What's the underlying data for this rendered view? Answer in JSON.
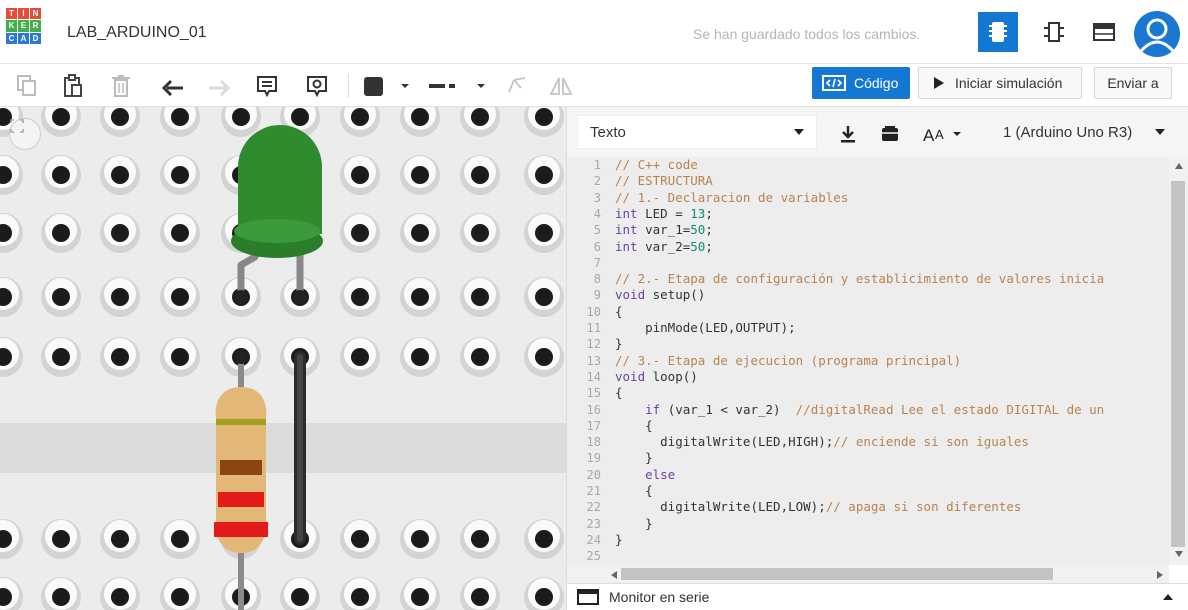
{
  "app": {
    "logo_letters": [
      "T",
      "I",
      "N",
      "K",
      "E",
      "R",
      "C",
      "A",
      "D"
    ],
    "logo_colors": [
      "#e84b3c",
      "#e84b3c",
      "#e84b3c",
      "#42b14b",
      "#42b14b",
      "#42b14b",
      "#2b7ad1",
      "#2b7ad1",
      "#2b7ad1"
    ],
    "project_title": "LAB_ARDUINO_01",
    "save_status": "Se han guardado todos los cambios."
  },
  "toolbar": {
    "code_label": "Código",
    "sim_label": "Iniciar simulación",
    "send_label": "Enviar a",
    "icons": [
      "copy-icon",
      "paste-icon",
      "trash-icon",
      "undo-icon",
      "redo-icon",
      "note-icon",
      "notes-visibility-icon",
      "color-swatch-icon",
      "line-style-icon",
      "mirror-icon",
      "flip-icon"
    ]
  },
  "code_panel": {
    "mode_select": "Texto",
    "board_select": "1 (Arduino Uno R3)",
    "monitor_label": "Monitor en serie",
    "lines": [
      {
        "n": "1",
        "segs": [
          {
            "t": "// C++ code",
            "c": "cm"
          }
        ]
      },
      {
        "n": "2",
        "segs": [
          {
            "t": "// ESTRUCTURA",
            "c": "cm"
          }
        ]
      },
      {
        "n": "3",
        "segs": [
          {
            "t": "// 1.- Declaracion de variables",
            "c": "cm"
          }
        ]
      },
      {
        "n": "4",
        "segs": [
          {
            "t": "int",
            "c": "kw"
          },
          {
            "t": " LED = ",
            "c": ""
          },
          {
            "t": "13",
            "c": "nm"
          },
          {
            "t": ";",
            "c": ""
          }
        ]
      },
      {
        "n": "5",
        "segs": [
          {
            "t": "int",
            "c": "kw"
          },
          {
            "t": " var_1=",
            "c": ""
          },
          {
            "t": "50",
            "c": "nm"
          },
          {
            "t": ";",
            "c": ""
          }
        ]
      },
      {
        "n": "6",
        "segs": [
          {
            "t": "int",
            "c": "kw"
          },
          {
            "t": " var_2=",
            "c": ""
          },
          {
            "t": "50",
            "c": "nm"
          },
          {
            "t": ";",
            "c": ""
          }
        ]
      },
      {
        "n": "7",
        "segs": []
      },
      {
        "n": "8",
        "segs": [
          {
            "t": "// 2.- Etapa de configuración y establicimiento de valores inicia",
            "c": "cm"
          }
        ]
      },
      {
        "n": "9",
        "segs": [
          {
            "t": "void",
            "c": "kw"
          },
          {
            "t": " setup()",
            "c": ""
          }
        ]
      },
      {
        "n": "10",
        "segs": [
          {
            "t": "{",
            "c": ""
          }
        ]
      },
      {
        "n": "11",
        "segs": [
          {
            "t": "    pinMode(LED,OUTPUT);",
            "c": ""
          }
        ]
      },
      {
        "n": "12",
        "segs": [
          {
            "t": "}",
            "c": ""
          }
        ]
      },
      {
        "n": "13",
        "segs": [
          {
            "t": "// 3.- Etapa de ejecucion (programa principal)",
            "c": "cm"
          }
        ]
      },
      {
        "n": "14",
        "segs": [
          {
            "t": "void",
            "c": "kw"
          },
          {
            "t": " loop()",
            "c": ""
          }
        ]
      },
      {
        "n": "15",
        "segs": [
          {
            "t": "{",
            "c": ""
          }
        ]
      },
      {
        "n": "16",
        "segs": [
          {
            "t": "    ",
            "c": ""
          },
          {
            "t": "if",
            "c": "kw"
          },
          {
            "t": " (var_1 < var_2)  ",
            "c": ""
          },
          {
            "t": "//digitalRead Lee el estado DIGITAL de un",
            "c": "cm"
          }
        ]
      },
      {
        "n": "17",
        "segs": [
          {
            "t": "    {",
            "c": ""
          }
        ]
      },
      {
        "n": "18",
        "segs": [
          {
            "t": "      digitalWrite(LED,HIGH);",
            "c": ""
          },
          {
            "t": "// enciende si son iguales",
            "c": "cm"
          }
        ]
      },
      {
        "n": "19",
        "segs": [
          {
            "t": "    }",
            "c": ""
          }
        ]
      },
      {
        "n": "20",
        "segs": [
          {
            "t": "    ",
            "c": ""
          },
          {
            "t": "else",
            "c": "kw"
          }
        ]
      },
      {
        "n": "21",
        "segs": [
          {
            "t": "    {",
            "c": ""
          }
        ]
      },
      {
        "n": "22",
        "segs": [
          {
            "t": "      digitalWrite(LED,LOW);",
            "c": ""
          },
          {
            "t": "// apaga si son diferentes",
            "c": "cm"
          }
        ]
      },
      {
        "n": "23",
        "segs": [
          {
            "t": "    }",
            "c": ""
          }
        ]
      },
      {
        "n": "24",
        "segs": [
          {
            "t": "}",
            "c": ""
          }
        ]
      },
      {
        "n": "25",
        "segs": []
      }
    ]
  },
  "circuit": {
    "led_color": "#2e8b2e",
    "resistor_bands": [
      "#5a3a1a",
      "#8b4513",
      "#e31b1b",
      "#e31b1b"
    ]
  }
}
